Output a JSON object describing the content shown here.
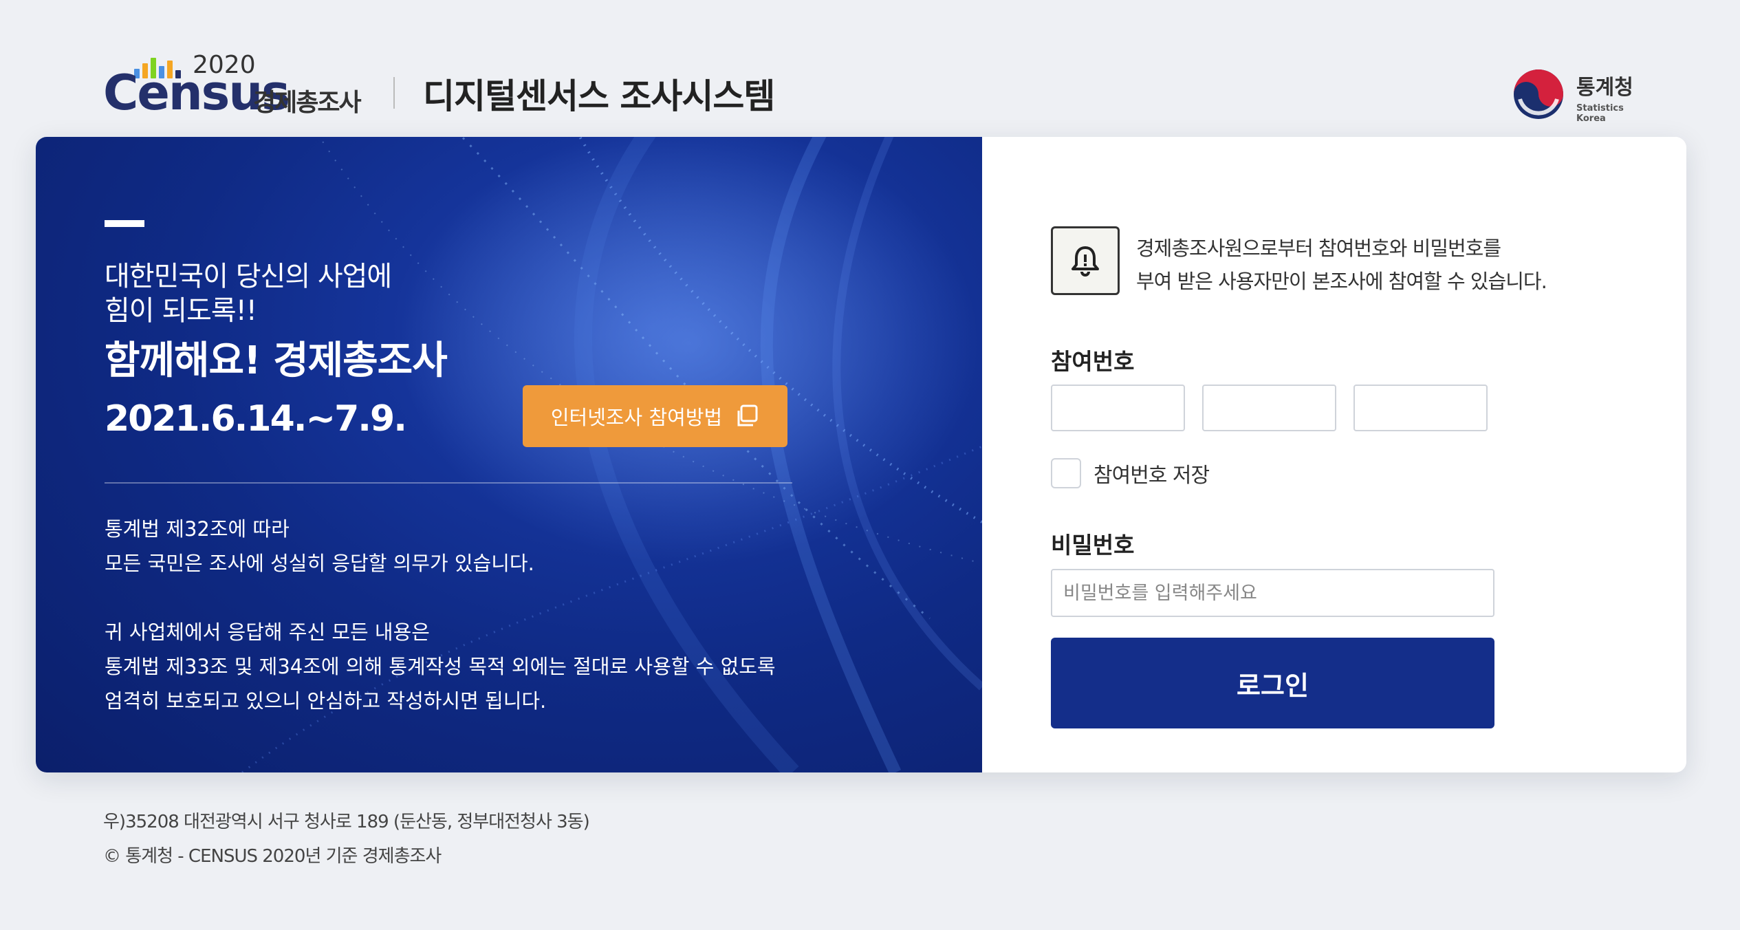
{
  "header": {
    "logo_year": "2020",
    "logo_word": "Census",
    "logo_sub": "경제총조사",
    "system_title": "디지털센서스 조사시스템",
    "agency_name": "통계청",
    "agency_eng": "Statistics Korea",
    "logo_bar_colors": [
      "#4a90e2",
      "#f5a623",
      "#7ed321",
      "#4a90e2",
      "#f5a623",
      "#24306b"
    ]
  },
  "hero": {
    "slogan_line1": "대한민국이 당신의 사업에\n힘이 되도록!!",
    "slogan_line2": "함께해요! 경제총조사",
    "period": "2021.6.14.~7.9.",
    "guide_button": "인터넷조사 참여방법",
    "law_lines_1": [
      "통계법 제32조에 따라",
      "모든 국민은 조사에 성실히 응답할 의무가 있습니다."
    ],
    "law_lines_2": [
      "귀 사업체에서 응답해 주신 모든 내용은",
      "통계법 제33조 및 제34조에 의해 통계작성 목적 외에는 절대로 사용할 수 없도록",
      "엄격히 보호되고 있으니 안심하고 작성하시면 됩니다."
    ],
    "background_color": "#0f2a85"
  },
  "login": {
    "notice_lines": [
      "경제총조사원으로부터 참여번호와 비밀번호를",
      "부여 받은 사용자만이 본조사에 참여할 수 있습니다."
    ],
    "participation_label": "참여번호",
    "participation_values": [
      "",
      "",
      ""
    ],
    "save_label": "참여번호 저장",
    "save_checked": false,
    "password_label": "비밀번호",
    "password_placeholder": "비밀번호를 입력해주세요",
    "password_value": "",
    "login_button": "로그인",
    "button_color": "#142e8a",
    "accent_color": "#ef9a3b"
  },
  "footer": {
    "address": "우)35208 대전광역시 서구 청사로 189 (둔산동, 정부대전청사 3동)",
    "copyright": "© 통계청 - CENSUS 2020년 기준 경제총조사"
  }
}
